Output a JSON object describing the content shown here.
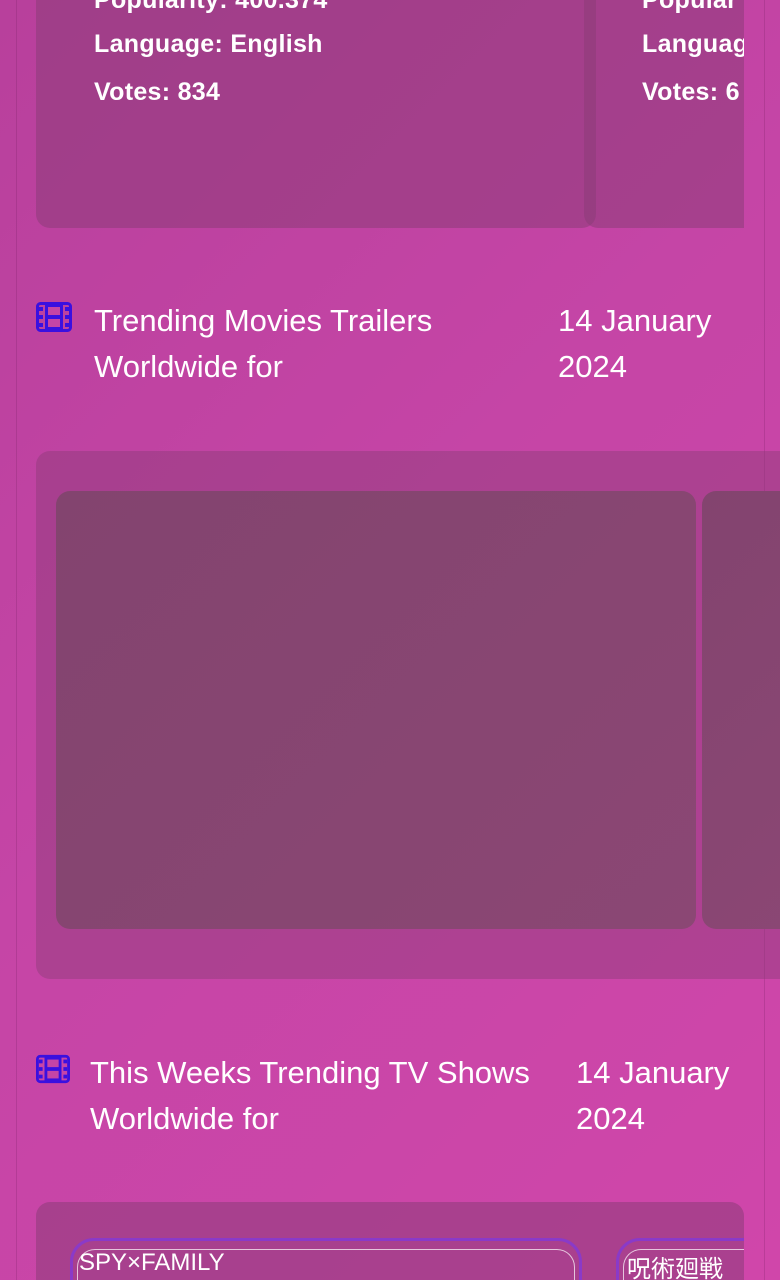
{
  "top_carousel": {
    "cards": [
      {
        "popularity_label": "Popularity: 400.374",
        "language_label": "Language: English",
        "votes_label": "Votes: 834"
      },
      {
        "popularity_label": "Popular",
        "language_label": "Languag",
        "votes_label": "Votes: 6"
      }
    ]
  },
  "trailers_section": {
    "icon": "film-icon",
    "title": "Trending Movies Trailers Worldwide for",
    "date": "14 January 2024"
  },
  "tv_section": {
    "icon": "film-icon",
    "title": "This Weeks Trending TV Shows Worldwide for",
    "date": "14 January 2024",
    "cards": [
      {
        "title": "SPY×FAMILY"
      },
      {
        "title": "呪術廻戦"
      }
    ]
  },
  "colors": {
    "background": "#c545a6",
    "icon": "#3a10e0",
    "card_border": "#8a3ac8"
  }
}
